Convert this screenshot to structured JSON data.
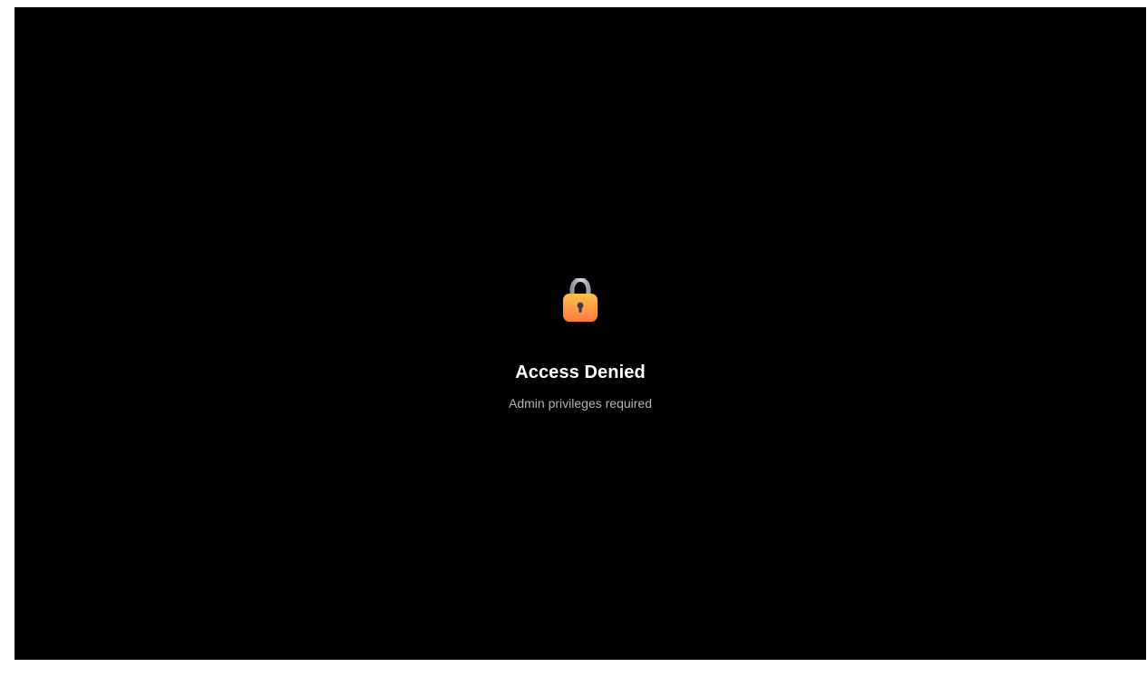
{
  "access_denied": {
    "icon": "lock-icon",
    "title": "Access Denied",
    "message": "Admin privileges required"
  },
  "colors": {
    "background": "#000000",
    "title_text": "#ffffff",
    "message_text": "#b3b3b3",
    "lock_body_top": "#ffbf4a",
    "lock_body_bottom": "#ff7a42",
    "lock_shackle": "#b8b8c8",
    "keyhole": "#3d3552"
  }
}
